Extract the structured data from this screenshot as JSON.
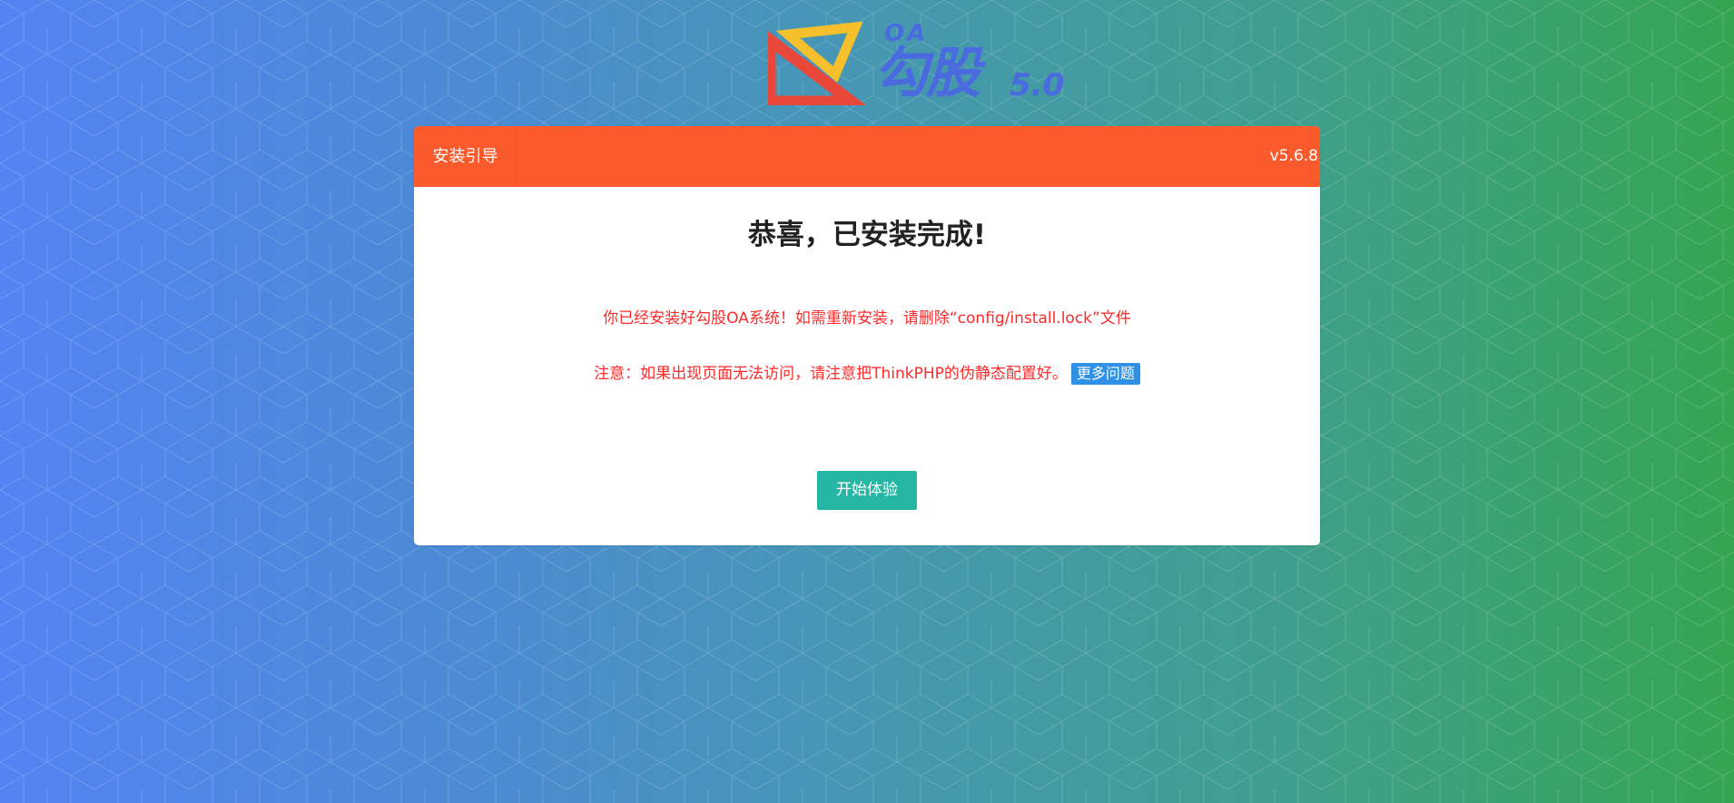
{
  "logo": {
    "oa": "OA",
    "name": "勾股",
    "version": "5.0"
  },
  "header": {
    "tab_label": "安装引导",
    "version": "v5.6.8"
  },
  "main": {
    "title": "恭喜，已安装完成!",
    "message": "你已经安装好勾股OA系统！如需重新安装，请删除“config/install.lock”文件",
    "notice": "注意：如果出现页面无法访问，请注意把ThinkPHP的伪静态配置好。",
    "more_link": "更多问题",
    "start_button": "开始体验"
  },
  "colors": {
    "header": "#fb5a2c",
    "button": "#26b7a4",
    "link": "#2f91e6",
    "message": "#ff2a2a",
    "logo_blue": "#4a6ae0",
    "logo_red": "#e8473a",
    "logo_yellow": "#f5c02c"
  }
}
